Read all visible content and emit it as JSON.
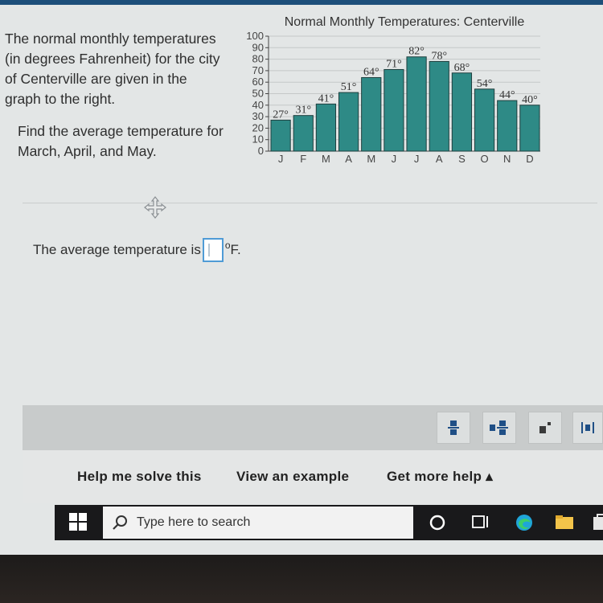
{
  "question": {
    "intro_lines": [
      "The normal monthly temperatures",
      "(in degrees Fahrenheit) for the city",
      "of Centerville are given in the",
      "graph to the right."
    ],
    "task_lines": [
      "Find the average temperature for",
      "March, April, and May."
    ]
  },
  "answer": {
    "prefix": "The average temperature is",
    "unit_deg": "o",
    "unit_suffix": "F."
  },
  "chart_data": {
    "type": "bar",
    "title": "Normal Monthly Temperatures: Centerville",
    "categories": [
      "J",
      "F",
      "M",
      "A",
      "M",
      "J",
      "J",
      "A",
      "S",
      "O",
      "N",
      "D"
    ],
    "values": [
      27,
      31,
      41,
      51,
      64,
      71,
      82,
      78,
      68,
      54,
      44,
      40
    ],
    "value_labels": [
      "27°",
      "31°",
      "41°",
      "51°",
      "64°",
      "71°",
      "82°",
      "78°",
      "68°",
      "54°",
      "44°",
      "40°"
    ],
    "y_ticks": [
      "0",
      "10",
      "20",
      "30",
      "40",
      "50",
      "60",
      "70",
      "80",
      "90",
      "100"
    ],
    "ylim": [
      0,
      100
    ],
    "bar_color": "#2e8a86",
    "grid": true
  },
  "toolbar": {
    "tools": [
      "fraction-icon",
      "mixed-number-icon",
      "exponent-icon",
      "absolute-value-icon"
    ]
  },
  "links": {
    "help": "Help me solve this",
    "example": "View an example",
    "more": "Get more help ▴"
  },
  "taskbar": {
    "search_placeholder": "Type here to search"
  },
  "colors": {
    "accent": "#1d4f7a",
    "answer_box_border": "#4f9bd6",
    "taskbar": "#19191b"
  }
}
